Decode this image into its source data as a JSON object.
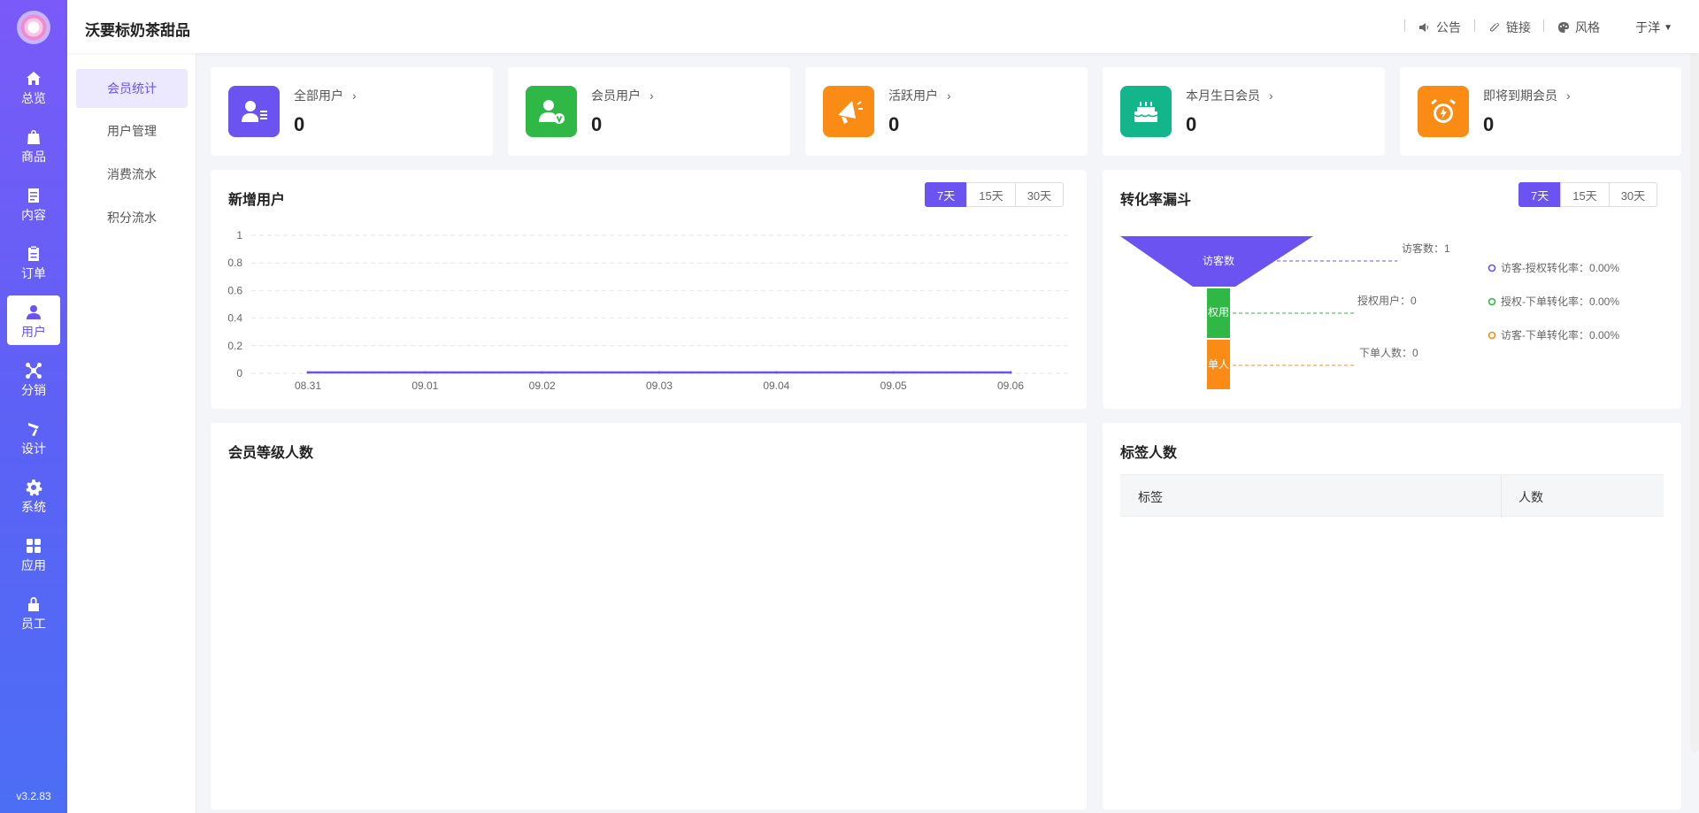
{
  "app": {
    "brand": "沃要标奶茶甜品",
    "version": "v3.2.83"
  },
  "rail": [
    {
      "id": "overview",
      "label": "总览",
      "icon": "home-icon"
    },
    {
      "id": "goods",
      "label": "商品",
      "icon": "bag-icon"
    },
    {
      "id": "content",
      "label": "内容",
      "icon": "document-icon"
    },
    {
      "id": "orders",
      "label": "订单",
      "icon": "clipboard-icon"
    },
    {
      "id": "users",
      "label": "用户",
      "icon": "user-icon",
      "active": true
    },
    {
      "id": "distribution",
      "label": "分销",
      "icon": "network-icon"
    },
    {
      "id": "design",
      "label": "设计",
      "icon": "brush-icon"
    },
    {
      "id": "system",
      "label": "系统",
      "icon": "gear-icon"
    },
    {
      "id": "apps",
      "label": "应用",
      "icon": "grid-icon"
    },
    {
      "id": "staff",
      "label": "员工",
      "icon": "lock-icon"
    }
  ],
  "submenu": [
    {
      "label": "会员统计",
      "active": true
    },
    {
      "label": "用户管理"
    },
    {
      "label": "消费流水"
    },
    {
      "label": "积分流水"
    }
  ],
  "topbar": {
    "notice": "公告",
    "links": "链接",
    "style": "风格",
    "user": "于洋"
  },
  "stats": [
    {
      "label": "全部用户",
      "value": "0",
      "color": "#6b53f2",
      "icon": "user-list-icon"
    },
    {
      "label": "会员用户",
      "value": "0",
      "color": "#2fb845",
      "icon": "vip-user-icon"
    },
    {
      "label": "活跃用户",
      "value": "0",
      "color": "#fa8c16",
      "icon": "megaphone-icon"
    },
    {
      "label": "本月生日会员",
      "value": "0",
      "color": "#13b58b",
      "icon": "cake-icon"
    },
    {
      "label": "即将到期会员",
      "value": "0",
      "color": "#fa8c16",
      "icon": "alarm-clock-icon"
    }
  ],
  "new_users": {
    "title": "新增用户",
    "ranges": [
      "7天",
      "15天",
      "30天"
    ],
    "active_range": "7天"
  },
  "funnel": {
    "title": "转化率漏斗",
    "ranges": [
      "7天",
      "15天",
      "30天"
    ],
    "stages": [
      {
        "label": "访客数",
        "annotation": "访客数：1",
        "color": "#6b53f2"
      },
      {
        "label": "权用",
        "annotation": "授权用户：0",
        "color": "#2fb845"
      },
      {
        "label": "单人",
        "annotation": "下单人数：0",
        "color": "#fa8c16"
      }
    ],
    "rates": [
      {
        "label": "访客-授权转化率：0.00%",
        "color": "#6b53f2"
      },
      {
        "label": "授权-下单转化率：0.00%",
        "color": "#2fb845"
      },
      {
        "label": "访客-下单转化率：0.00%",
        "color": "#fa8c16"
      }
    ]
  },
  "member_levels": {
    "title": "会员等级人数"
  },
  "tags": {
    "title": "标签人数",
    "columns": [
      "标签",
      "人数"
    ]
  },
  "chart_data": {
    "type": "line",
    "x": [
      "08.31",
      "09.01",
      "09.02",
      "09.03",
      "09.04",
      "09.05",
      "09.06"
    ],
    "series": [
      {
        "values": [
          0,
          0,
          0,
          0,
          0,
          0,
          0
        ],
        "color": "#6b53f2"
      }
    ],
    "yticks": [
      "0",
      "0.2",
      "0.4",
      "0.6",
      "0.8",
      "1"
    ],
    "ylim": [
      0,
      1
    ],
    "grid": true
  }
}
